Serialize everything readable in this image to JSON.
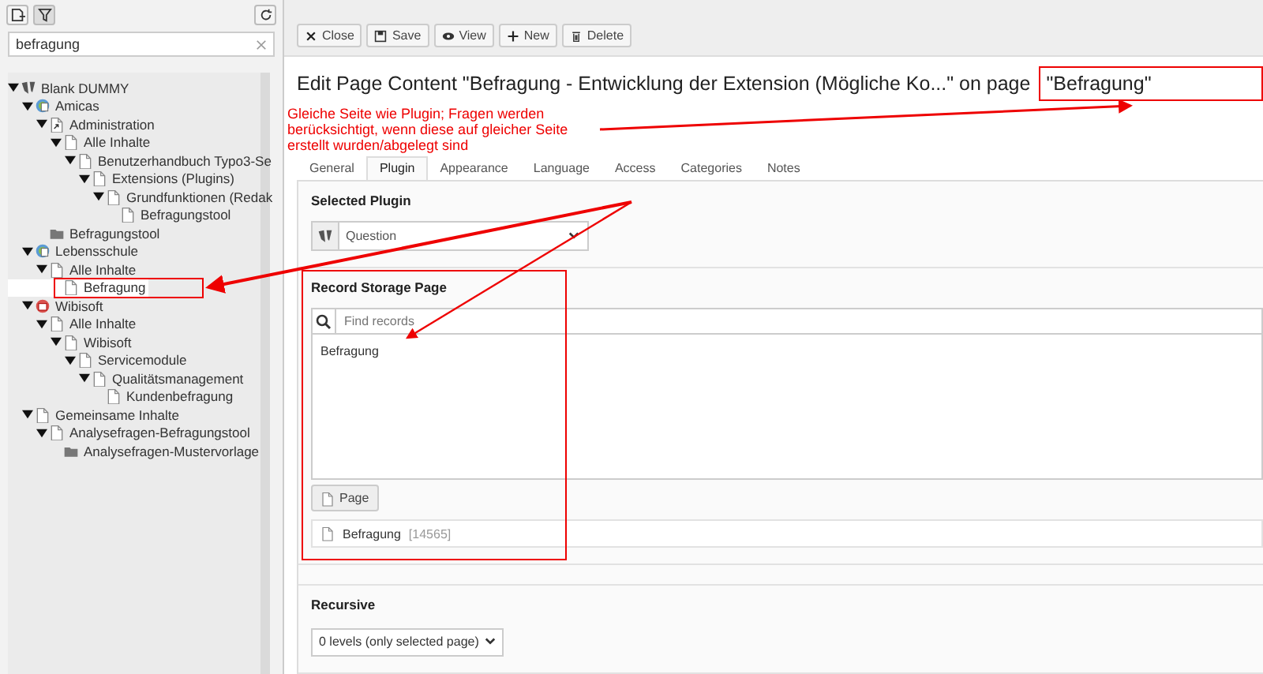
{
  "left_panel": {
    "search": {
      "value": "befragung"
    },
    "tree": [
      {
        "label": "Blank DUMMY",
        "kind": "root",
        "expanded": true,
        "selected": false,
        "children": [
          {
            "label": "Amicas",
            "kind": "site",
            "expanded": true,
            "selected": false,
            "children": [
              {
                "label": "Administration",
                "kind": "shortcut",
                "expanded": true,
                "selected": false,
                "children": [
                  {
                    "label": "Alle Inhalte",
                    "kind": "page",
                    "expanded": true,
                    "selected": false,
                    "children": [
                      {
                        "label": "Benutzerhandbuch Typo3-Se",
                        "kind": "page",
                        "expanded": true,
                        "selected": false,
                        "children": [
                          {
                            "label": "Extensions (Plugins)",
                            "kind": "page",
                            "expanded": true,
                            "selected": false,
                            "children": [
                              {
                                "label": "Grundfunktionen (Redak",
                                "kind": "page",
                                "expanded": true,
                                "selected": false,
                                "children": [
                                  {
                                    "label": "Befragungstool",
                                    "kind": "page",
                                    "selected": false
                                  }
                                ]
                              }
                            ]
                          }
                        ]
                      }
                    ]
                  }
                ]
              },
              {
                "label": "Befragungstool",
                "kind": "folder",
                "selected": false
              }
            ]
          },
          {
            "label": "Lebensschule",
            "kind": "site",
            "expanded": true,
            "selected": false,
            "children": [
              {
                "label": "Alle Inhalte",
                "kind": "page",
                "expanded": true,
                "selected": false,
                "children": [
                  {
                    "label": "Befragung",
                    "kind": "page",
                    "selected": true
                  }
                ]
              }
            ]
          },
          {
            "label": "Wibisoft",
            "kind": "site-red",
            "expanded": true,
            "selected": false,
            "children": [
              {
                "label": "Alle Inhalte",
                "kind": "page",
                "expanded": true,
                "selected": false,
                "children": [
                  {
                    "label": "Wibisoft",
                    "kind": "page",
                    "expanded": true,
                    "selected": false,
                    "children": [
                      {
                        "label": "Servicemodule",
                        "kind": "page",
                        "expanded": true,
                        "selected": false,
                        "children": [
                          {
                            "label": "Qualitätsmanagement",
                            "kind": "page",
                            "expanded": true,
                            "selected": false,
                            "children": [
                              {
                                "label": "Kundenbefragung",
                                "kind": "page",
                                "selected": false
                              }
                            ]
                          }
                        ]
                      }
                    ]
                  }
                ]
              }
            ]
          },
          {
            "label": "Gemeinsame Inhalte",
            "kind": "page",
            "expanded": true,
            "selected": false,
            "children": [
              {
                "label": "Analysefragen-Befragungstool",
                "kind": "page",
                "expanded": true,
                "selected": false,
                "children": [
                  {
                    "label": "Analysefragen-Mustervorlage",
                    "kind": "folder",
                    "selected": false
                  }
                ]
              }
            ]
          }
        ]
      }
    ]
  },
  "toolbar": [
    {
      "label": "Close",
      "kind": "close"
    },
    {
      "label": "Save",
      "kind": "save"
    },
    {
      "label": "View",
      "kind": "view"
    },
    {
      "label": "New",
      "kind": "new"
    },
    {
      "label": "Delete",
      "kind": "delete"
    }
  ],
  "title": "Edit Page Content \"Befragung - Entwicklung der Extension (Mögliche Ko...\" on page",
  "title_page": "\"Befragung\"",
  "tabs": [
    {
      "label": "General",
      "selected": false
    },
    {
      "label": "Plugin",
      "selected": true
    },
    {
      "label": "Appearance",
      "selected": false
    },
    {
      "label": "Language",
      "selected": false
    },
    {
      "label": "Access",
      "selected": false
    },
    {
      "label": "Categories",
      "selected": false
    },
    {
      "label": "Notes",
      "selected": false
    }
  ],
  "selected_plugin": {
    "label": "Selected Plugin",
    "value": "Question"
  },
  "record_storage": {
    "label": "Record Storage Page",
    "placeholder": "Find records",
    "items": [
      "Befragung"
    ],
    "page_button": "Page",
    "record": "Befragung",
    "record_id": "[14565]"
  },
  "recursive": {
    "label": "Recursive",
    "value": "0 levels (only selected page)"
  },
  "annotation": {
    "lines": [
      "Gleiche Seite wie Plugin; Fragen werden",
      "berücksichtigt, wenn diese auf gleicher Seite",
      "erstellt wurden/abgelegt sind"
    ]
  }
}
